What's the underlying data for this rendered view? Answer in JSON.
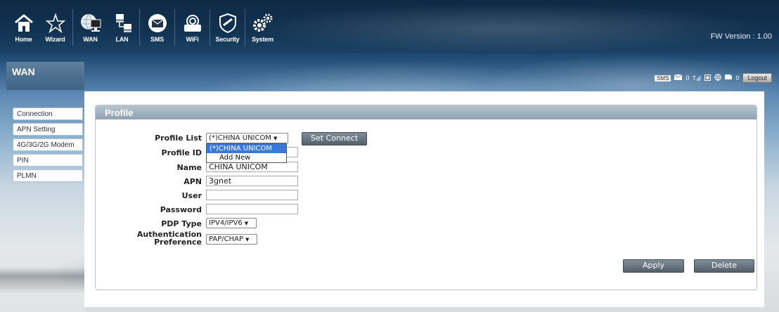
{
  "nav": {
    "items": [
      {
        "label": "Home",
        "icon": "home-icon"
      },
      {
        "label": "Wizard",
        "icon": "wizard-icon"
      },
      {
        "label": "WAN",
        "icon": "wan-icon"
      },
      {
        "label": "LAN",
        "icon": "lan-icon"
      },
      {
        "label": "SMS",
        "icon": "sms-icon"
      },
      {
        "label": "WiFi",
        "icon": "wifi-icon"
      },
      {
        "label": "Security",
        "icon": "security-icon"
      },
      {
        "label": "System",
        "icon": "system-icon"
      }
    ],
    "fw_version": "FW Version : 1.00"
  },
  "section": {
    "title": "WAN"
  },
  "status": {
    "sms_badge": "SMS",
    "message_count": "0",
    "signal_icon": "signal-icon",
    "sim_icon": "sim-icon",
    "globe_icon": "globe-icon",
    "wifi_client_count": "0",
    "logout_label": "Logout"
  },
  "sidebar": {
    "items": [
      {
        "label": "Connection"
      },
      {
        "label": "APN Setting"
      },
      {
        "label": "4G/3G/2G Modem"
      },
      {
        "label": "PIN"
      },
      {
        "label": "PLMN"
      }
    ]
  },
  "profile": {
    "header": "Profile",
    "profile_list_label": "Profile List",
    "profile_list_value": "(*)CHINA UNICOM",
    "set_connect_label": "Set Connect",
    "dropdown_options": [
      "(*)CHINA UNICOM",
      "Add New"
    ],
    "profile_id_label": "Profile ID",
    "profile_id_value": "",
    "name_label": "Name",
    "name_value": "CHINA UNICOM",
    "apn_label": "APN",
    "apn_value": "3gnet",
    "user_label": "User",
    "user_value": "",
    "password_label": "Password",
    "password_value": "",
    "pdp_type_label": "PDP Type",
    "pdp_type_value": "IPV4/IPV6",
    "auth_label_line1": "Authentication",
    "auth_label_line2": "Preference",
    "auth_value": "PAP/CHAP",
    "apply_label": "Apply",
    "delete_label": "Delete"
  },
  "colors": {
    "nav_bg": "#123352",
    "panel_header": "#9fb0bf",
    "button": "#5f6c78",
    "selected_option": "#3b79d8"
  }
}
